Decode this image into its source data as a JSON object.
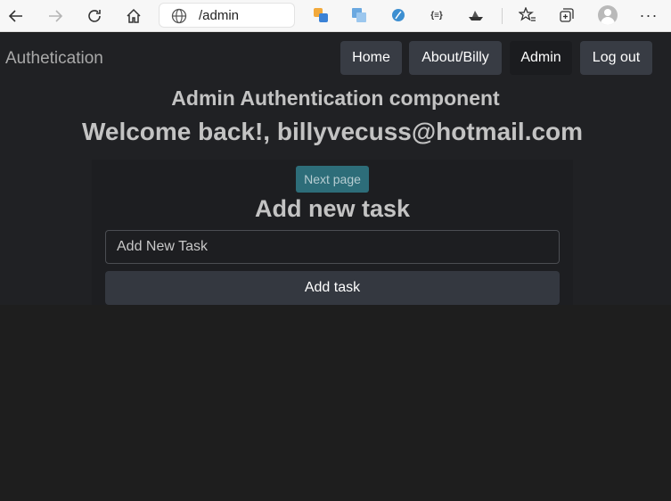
{
  "browser": {
    "url": "/admin",
    "icons": [
      "back-arrow-icon",
      "forward-arrow-icon",
      "reload-icon",
      "home-icon",
      "globe-icon",
      "translate-icon",
      "translator-icon",
      "extension-icon",
      "json-icon",
      "ship-icon",
      "favorites-icon",
      "collections-icon",
      "profile-icon",
      "more-icon"
    ],
    "json_ext_label": "{≡}",
    "more_label": "···"
  },
  "navbar": {
    "brand": "Authetication",
    "links": [
      {
        "label": "Home"
      },
      {
        "label": "About/Billy"
      },
      {
        "label": "Admin"
      },
      {
        "label": "Log out"
      }
    ]
  },
  "header": {
    "title": "Admin Authentication component",
    "welcome": "Welcome back!, billyvecuss@hotmail.com"
  },
  "card": {
    "next_label": "Next page",
    "title": "Add new task",
    "input_placeholder": "Add New Task",
    "add_label": "Add task"
  },
  "colors": {
    "background": "#1e1e1e",
    "navbar": "#202124",
    "button": "#383c44",
    "next_button": "#2d6d79"
  }
}
